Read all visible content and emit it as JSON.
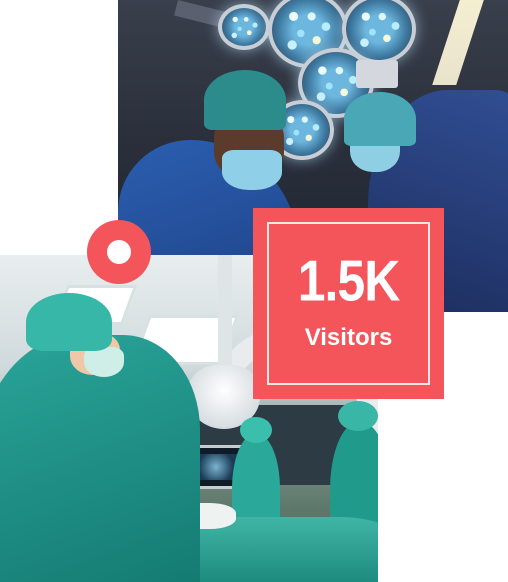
{
  "stat": {
    "value": "1.5K",
    "label": "Visitors"
  },
  "colors": {
    "accent": "#f4555b",
    "background": "#ffffff",
    "text_on_accent": "#ffffff"
  },
  "icons": {
    "decor_ring": "ring-icon"
  }
}
